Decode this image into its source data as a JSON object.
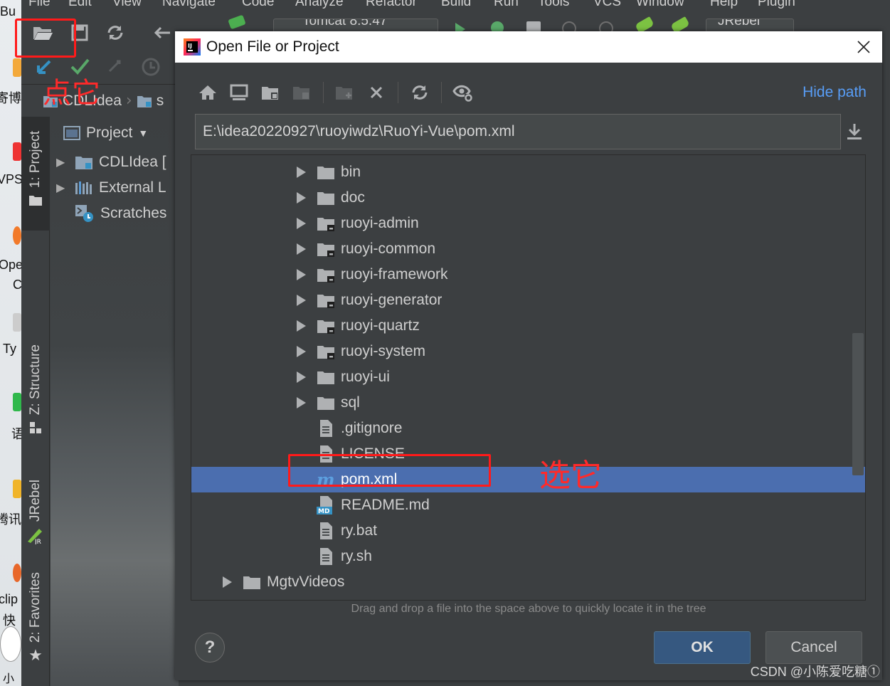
{
  "desktop": {
    "labels": [
      "Bu",
      "寄博",
      "VPS",
      "Ope",
      "C",
      "Ty",
      "语",
      "腾讯",
      "clip",
      "快",
      "小"
    ]
  },
  "menubar": {
    "items": [
      "File",
      "Edit",
      "View",
      "Navigate",
      "Code",
      "Analyze",
      "Refactor",
      "Build",
      "Run",
      "Tools",
      "VCS",
      "Window",
      "Help",
      "Plugin"
    ]
  },
  "toolbar": {
    "run_config": "Tomcat 8.5.47",
    "jrebel": "JRebel"
  },
  "breadcrumb": {
    "items": [
      "CDLIdea",
      "s"
    ]
  },
  "tool_stripe": {
    "project": "1: Project",
    "structure": "Z: Structure",
    "jrebel": "JRebel",
    "favorites": "2: Favorites"
  },
  "project_panel": {
    "title": "Project",
    "items": [
      {
        "label": "CDLIdea [",
        "type": "module"
      },
      {
        "label": "External L",
        "type": "libraries"
      },
      {
        "label": "Scratches",
        "type": "scratches"
      }
    ]
  },
  "annotations": {
    "click_it": "点它",
    "select_it": "选它"
  },
  "dialog": {
    "title": "Open File or Project",
    "hide_path": "Hide path",
    "path_value": "E:\\idea20220927\\ruoyiwdz\\RuoYi-Vue\\pom.xml",
    "hint": "Drag and drop a file into the space above to quickly locate it in the tree",
    "ok_label": "OK",
    "cancel_label": "Cancel",
    "help_label": "?",
    "tree": [
      {
        "label": "bin",
        "kind": "folder",
        "expandable": true,
        "depth": 2
      },
      {
        "label": "doc",
        "kind": "folder",
        "expandable": true,
        "depth": 2
      },
      {
        "label": "ruoyi-admin",
        "kind": "module",
        "expandable": true,
        "depth": 2
      },
      {
        "label": "ruoyi-common",
        "kind": "module",
        "expandable": true,
        "depth": 2
      },
      {
        "label": "ruoyi-framework",
        "kind": "module",
        "expandable": true,
        "depth": 2
      },
      {
        "label": "ruoyi-generator",
        "kind": "module",
        "expandable": true,
        "depth": 2
      },
      {
        "label": "ruoyi-quartz",
        "kind": "module",
        "expandable": true,
        "depth": 2
      },
      {
        "label": "ruoyi-system",
        "kind": "module",
        "expandable": true,
        "depth": 2
      },
      {
        "label": "ruoyi-ui",
        "kind": "folder",
        "expandable": true,
        "depth": 2
      },
      {
        "label": "sql",
        "kind": "folder",
        "expandable": true,
        "depth": 2
      },
      {
        "label": ".gitignore",
        "kind": "file",
        "expandable": false,
        "depth": 2
      },
      {
        "label": "LICENSE",
        "kind": "file",
        "expandable": false,
        "depth": 2
      },
      {
        "label": "pom.xml",
        "kind": "maven",
        "expandable": false,
        "depth": 2,
        "selected": true
      },
      {
        "label": "README.md",
        "kind": "markdown",
        "expandable": false,
        "depth": 2
      },
      {
        "label": "ry.bat",
        "kind": "file",
        "expandable": false,
        "depth": 2
      },
      {
        "label": "ry.sh",
        "kind": "file",
        "expandable": false,
        "depth": 2
      },
      {
        "label": "MgtvVideos",
        "kind": "folder",
        "expandable": true,
        "depth": 1
      }
    ]
  },
  "watermark": "CSDN @小陈爱吃糖①",
  "colors": {
    "selection": "#4b6eaf",
    "link": "#589df6",
    "annotation": "#ff1a1a",
    "ok_button": "#365880"
  }
}
